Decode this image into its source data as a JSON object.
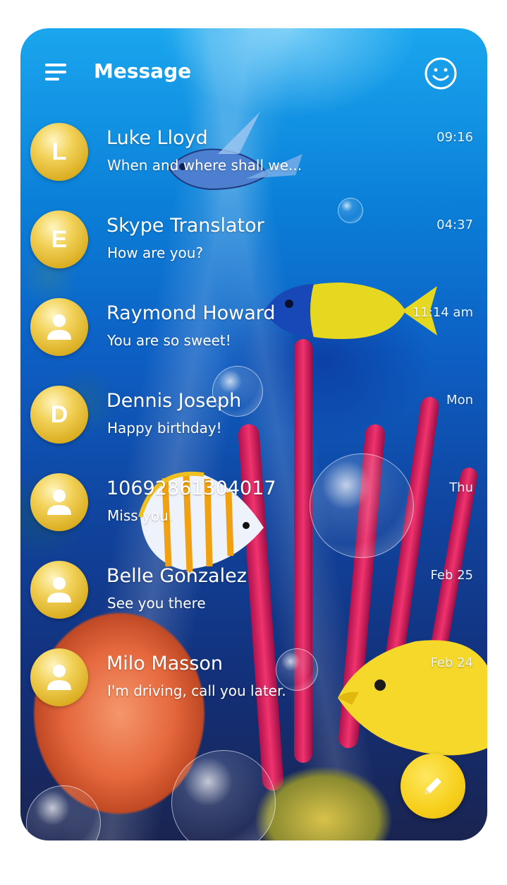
{
  "header": {
    "title": "Message",
    "menu_icon": "menu-icon",
    "profile_icon": "smiley-icon"
  },
  "conversations": [
    {
      "avatar_type": "letter",
      "avatar_letter": "L",
      "name": "Luke Lloyd",
      "preview": "When and where shall we...",
      "time": "09:16"
    },
    {
      "avatar_type": "letter",
      "avatar_letter": "E",
      "name": "Skype Translator",
      "preview": "How are you?",
      "time": "04:37"
    },
    {
      "avatar_type": "person",
      "avatar_letter": "",
      "name": "Raymond Howard",
      "preview": "You are so sweet!",
      "time": "11:14 am"
    },
    {
      "avatar_type": "letter",
      "avatar_letter": "D",
      "name": "Dennis Joseph",
      "preview": "Happy birthday!",
      "time": "Mon"
    },
    {
      "avatar_type": "person",
      "avatar_letter": "",
      "name": "10692861304017",
      "preview": "Miss you.",
      "time": "Thu"
    },
    {
      "avatar_type": "person",
      "avatar_letter": "",
      "name": "Belle Gonzalez",
      "preview": "See you there",
      "time": "Feb 25"
    },
    {
      "avatar_type": "person",
      "avatar_letter": "",
      "name": "Milo Masson",
      "preview": "I'm driving, call you later.",
      "time": "Feb 24"
    }
  ],
  "compose_button": {
    "icon": "pencil-icon"
  },
  "colors": {
    "accent_gold": "#e9b90c",
    "text": "#ffffff",
    "background_top": "#1aa6ee",
    "background_bottom": "#1a2450"
  }
}
